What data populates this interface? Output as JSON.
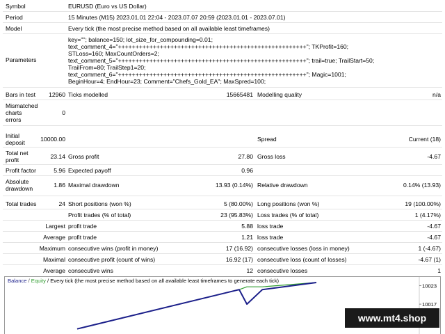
{
  "header": {
    "symbol_label": "Symbol",
    "symbol_value": "EURUSD (Euro vs US Dollar)",
    "period_label": "Period",
    "period_value": "15 Minutes (M15) 2023.01.01 22:04 - 2023.07.07 20:59 (2023.01.01 - 2023.07.01)",
    "model_label": "Model",
    "model_value": "Every tick (the most precise method based on all available least timeframes)",
    "parameters_label": "Parameters",
    "parameters_lines": [
      "key=\"\"; balance=150; lot_size_for_compounding=0.01;",
      "text_comment_4=\"++++++++++++++++++++++++++++++++++++++++++++++++++++++\"; TKProfit=160;",
      "STLoss=160; MaxCountOrders=2;",
      "text_comment_5=\"++++++++++++++++++++++++++++++++++++++++++++++++++++++\"; trail=true; TrailStart=50;",
      "TrailFrom=80; TrailStep1=20;",
      "text_comment_6=\"++++++++++++++++++++++++++++++++++++++++++++++++++++++\"; Magic=1001;",
      "BeginHour=4; EndHour=23; Comment=\"Chefs_Gold_EA\"; MaxSpred=100;"
    ]
  },
  "stats": {
    "bars_label": "Bars in test",
    "bars_value": "12960",
    "ticks_label": "Ticks modelled",
    "ticks_value": "15665481",
    "quality_label": "Modelling quality",
    "quality_value": "n/a",
    "mismatched_label_1": "Mismatched",
    "mismatched_label_2": "charts",
    "mismatched_label_3": "errors",
    "mismatched_value": "0",
    "initial_label_1": "Initial",
    "initial_label_2": "deposit",
    "initial_value": "10000.00",
    "spread_label": "Spread",
    "spread_value": "Current (18)",
    "net_label_1": "Total net",
    "net_label_2": "profit",
    "net_value": "23.14",
    "gross_profit_label": "Gross profit",
    "gross_profit_value": "27.80",
    "gross_loss_label": "Gross loss",
    "gross_loss_value": "-4.67",
    "pf_label": "Profit factor",
    "pf_value": "5.96",
    "payoff_label": "Expected payoff",
    "payoff_value": "0.96",
    "absdd_label_1": "Absolute",
    "absdd_label_2": "drawdown",
    "absdd_value": "1.86",
    "maxdd_label": "Maximal drawdown",
    "maxdd_value": "13.93 (0.14%)",
    "reldd_label": "Relative drawdown",
    "reldd_value": "0.14% (13.93)"
  },
  "trades": {
    "total_label": "Total trades",
    "total_value": "24",
    "short_label": "Short positions (won %)",
    "short_value": "5 (80.00%)",
    "long_label": "Long positions (won %)",
    "long_value": "19 (100.00%)",
    "profit_trades_label": "Profit trades (% of total)",
    "profit_trades_value": "23 (95.83%)",
    "loss_trades_label": "Loss trades (% of total)",
    "loss_trades_value": "1 (4.17%)",
    "largest_label": "Largest",
    "largest_profit_label": "profit trade",
    "largest_profit_value": "5.88",
    "largest_loss_label": "loss trade",
    "largest_loss_value": "-4.67",
    "average_label": "Average",
    "average_profit_label": "profit trade",
    "average_profit_value": "1.21",
    "average_loss_label": "loss trade",
    "average_loss_value": "-4.67",
    "maximum_label": "Maximum",
    "max_wins_label": "consecutive wins (profit in money)",
    "max_wins_value": "17 (16.92)",
    "max_losses_label": "consecutive losses (loss in money)",
    "max_losses_value": "1 (-4.67)",
    "maximal_label": "Maximal",
    "maximal_wins_label": "consecutive profit (count of wins)",
    "maximal_wins_value": "16.92 (17)",
    "maximal_losses_label": "consecutive loss (count of losses)",
    "maximal_losses_value": "-4.67 (1)",
    "average2_label": "Average",
    "avg_wins_label": "consecutive wins",
    "avg_wins_value": "12",
    "avg_losses_label": "consecutive losses",
    "avg_losses_value": "1"
  },
  "chart_data": {
    "type": "line",
    "legend": {
      "balance": "Balance",
      "sep1": " / ",
      "equity": "Equity",
      "rest": " / Every tick (the most precise method based on all available least timeframes to generate each tick)"
    },
    "y_ticks": [
      "10023",
      "10017"
    ],
    "series": [
      {
        "name": "Balance",
        "color": "#1b1f8a",
        "points": [
          [
            0,
            10009.0
          ],
          [
            21,
            10021.7
          ],
          [
            22,
            10017.0
          ],
          [
            24,
            10021.7
          ],
          [
            31,
            10024.0
          ]
        ]
      },
      {
        "name": "Equity",
        "color": "#2e9c2e",
        "points": [
          [
            0,
            10009.0
          ],
          [
            21,
            10021.7
          ],
          [
            22,
            10022.6
          ],
          [
            24,
            10022.6
          ],
          [
            31,
            10024.0
          ]
        ]
      }
    ],
    "ylim": [
      10006,
      10025.8
    ],
    "xlim": [
      0,
      31
    ]
  },
  "watermark": "www.mt4.shop"
}
